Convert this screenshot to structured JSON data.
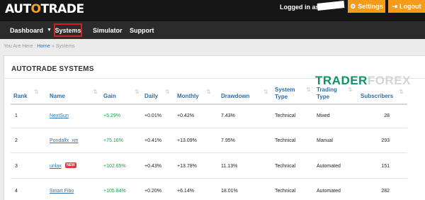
{
  "header": {
    "logo_prefix": "AUT",
    "logo_accent": "O",
    "logo_suffix": "TRADE",
    "login_text": "Logged in as",
    "settings_label": "Settings",
    "logout_label": "Logout",
    "accent_color": "#f39c1c"
  },
  "nav": {
    "items": [
      {
        "label": "Dashboard"
      },
      {
        "label": "Systems"
      },
      {
        "label": "Simulator"
      },
      {
        "label": "Support"
      }
    ],
    "active_item": "Systems"
  },
  "breadcrumb": {
    "prefix": "You Are Here :",
    "home": "Home",
    "separator": "»",
    "current": "Systems"
  },
  "panel": {
    "title": "AUTOTRADE SYSTEMS"
  },
  "watermark": {
    "part_a": "TRADER",
    "part_b": "FOREX"
  },
  "table": {
    "headers": {
      "rank": "Rank",
      "name": "Name",
      "gain": "Gain",
      "daily": "Daily",
      "monthly": "Monthly",
      "drawdown": "Drawdown",
      "system_type_1": "System",
      "system_type_2": "Type",
      "trading_type_1": "Trading",
      "trading_type_2": "Type",
      "subscribers": "Subscribers"
    },
    "rows": [
      {
        "rank": "1",
        "name": "NextSun",
        "gain": "+5.29%",
        "daily": "+0.01%",
        "monthly": "+0.42%",
        "drawdown": "7.43%",
        "system_type": "Technical",
        "trading_type": "Mixed",
        "subscribers": "28"
      },
      {
        "rank": "2",
        "name": "Pondalfx_xm",
        "gain": "+75.16%",
        "daily": "+0.41%",
        "monthly": "+13.09%",
        "drawdown": "7.95%",
        "system_type": "Technical",
        "trading_type": "Manual",
        "subscribers": "293"
      },
      {
        "rank": "3",
        "name": "unlax",
        "badge": "NEW",
        "gain": "+102.65%",
        "daily": "+0.43%",
        "monthly": "+13.78%",
        "drawdown": "11.13%",
        "system_type": "Technical",
        "trading_type": "Automated",
        "subscribers": "151"
      },
      {
        "rank": "4",
        "name": "Smart Fibo",
        "gain": "+105.84%",
        "daily": "+0.20%",
        "monthly": "+6.14%",
        "drawdown": "18.01%",
        "system_type": "Technical",
        "trading_type": "Automated",
        "subscribers": "282"
      }
    ]
  },
  "icons": {
    "settings": "gear-icon",
    "logout": "logout-icon",
    "dashboard_caret": "chevron-down-icon",
    "sort": "sort-icon"
  },
  "colors": {
    "topbar": "#161616",
    "navbar": "#2b2b2b",
    "link": "#2b74b4",
    "gain": "#1f9a4a",
    "active_outline": "#d22020",
    "badge": "#e23a3a"
  }
}
